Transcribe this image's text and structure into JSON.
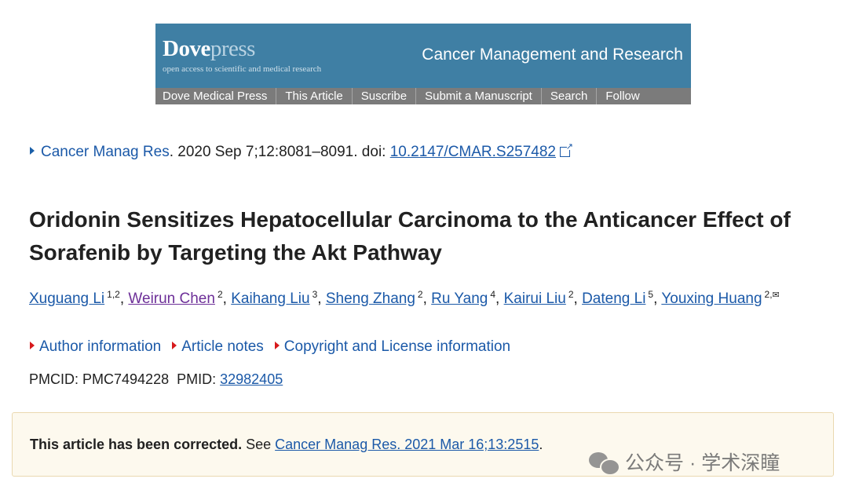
{
  "banner": {
    "logo_main": "Dove",
    "logo_accent": "press",
    "tagline": "open access to scientific and medical research",
    "journal_name": "Cancer Management and Research",
    "nav": [
      "Dove Medical Press",
      "This Article",
      "Suscribe",
      "Submit a Manuscript",
      "Search",
      "Follow"
    ],
    "bg_color": "#3f7fa4"
  },
  "citation": {
    "journal_link": "Cancer Manag Res",
    "details": ". 2020 Sep 7;12:8081–8091. doi: ",
    "doi": "10.2147/CMAR.S257482"
  },
  "article": {
    "title": "Oridonin Sensitizes Hepatocellular Carcinoma to the Anticancer Effect of Sorafenib by Targeting the Akt Pathway"
  },
  "authors": [
    {
      "name": "Xuguang Li",
      "aff": "1,2",
      "sep": ", "
    },
    {
      "name": "Weirun Chen",
      "aff": "2",
      "sep": ", "
    },
    {
      "name": "Kaihang Liu",
      "aff": "3",
      "sep": ", "
    },
    {
      "name": "Sheng Zhang",
      "aff": "2",
      "sep": ", "
    },
    {
      "name": "Ru Yang",
      "aff": "4",
      "sep": ", "
    },
    {
      "name": "Kairui Liu",
      "aff": "2",
      "sep": ", "
    },
    {
      "name": "Dateng Li",
      "aff": "5",
      "sep": ", "
    },
    {
      "name": "Youxing Huang",
      "aff": "2,",
      "sep": ""
    }
  ],
  "info_links": [
    "Author information",
    "Article notes",
    "Copyright and License information"
  ],
  "ids": {
    "pmcid_label": "PMCID: ",
    "pmcid": "PMC7494228",
    "pmid_label": "PMID: ",
    "pmid": "32982405"
  },
  "correction": {
    "bold": "This article has been corrected.",
    "see": " See ",
    "link": "Cancer Manag Res. 2021 Mar 16;13:2515",
    "end": "."
  },
  "watermark": {
    "text": "公众号 · 学术深瞳"
  }
}
